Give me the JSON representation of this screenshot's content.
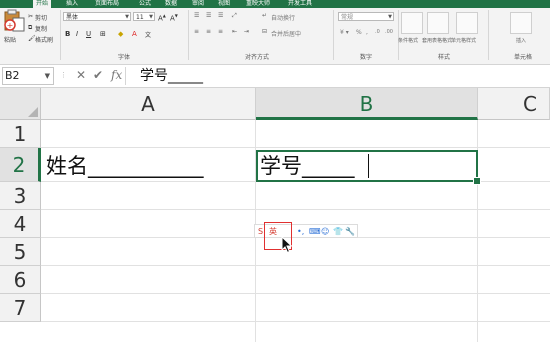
{
  "ribbon": {
    "tabs": [
      {
        "label": "开始",
        "active": true
      },
      {
        "label": "插入",
        "active": false
      },
      {
        "label": "页面布局",
        "active": false
      },
      {
        "label": "公式",
        "active": false
      },
      {
        "label": "数据",
        "active": false
      },
      {
        "label": "审阅",
        "active": false
      },
      {
        "label": "视图",
        "active": false
      },
      {
        "label": "重映大师",
        "active": false
      },
      {
        "label": "开发工具",
        "active": false
      }
    ],
    "clipboard": {
      "paste": "粘贴",
      "cut": "剪切",
      "copy": "复制",
      "format_painter": "格式刷"
    },
    "font": {
      "name": "黑体",
      "size": "11",
      "group_label": "字体"
    },
    "alignment": {
      "wrap_text": "自动换行",
      "merge_center": "合并后居中",
      "group_label": "对齐方式"
    },
    "number": {
      "format": "常规",
      "group_label": "数字"
    },
    "styles": {
      "conditional_format": "条件格式",
      "table_format": "套用表格格式",
      "cell_styles": "单元格样式",
      "group_label": "样式"
    },
    "cells": {
      "insert": "插入",
      "group_label": "单元格"
    }
  },
  "formula_bar": {
    "name_box": "B2",
    "cancel_icon": "✕",
    "enter_icon": "✔",
    "fx_label": "fx",
    "content": "学号_____"
  },
  "sheet": {
    "columns": [
      "A",
      "B",
      "C"
    ],
    "rows": [
      "1",
      "2",
      "3",
      "4",
      "5",
      "6",
      "7"
    ],
    "selected_cell": "B2",
    "cells": {
      "A2": "姓名___________",
      "B2": "学号_____"
    }
  },
  "ime_toolbar": {
    "mode": "英",
    "items": [
      "•,",
      "⌨",
      "☺",
      "👕",
      "🔧"
    ]
  },
  "colors": {
    "accent": "#217346",
    "ime_highlight": "#e03030"
  }
}
